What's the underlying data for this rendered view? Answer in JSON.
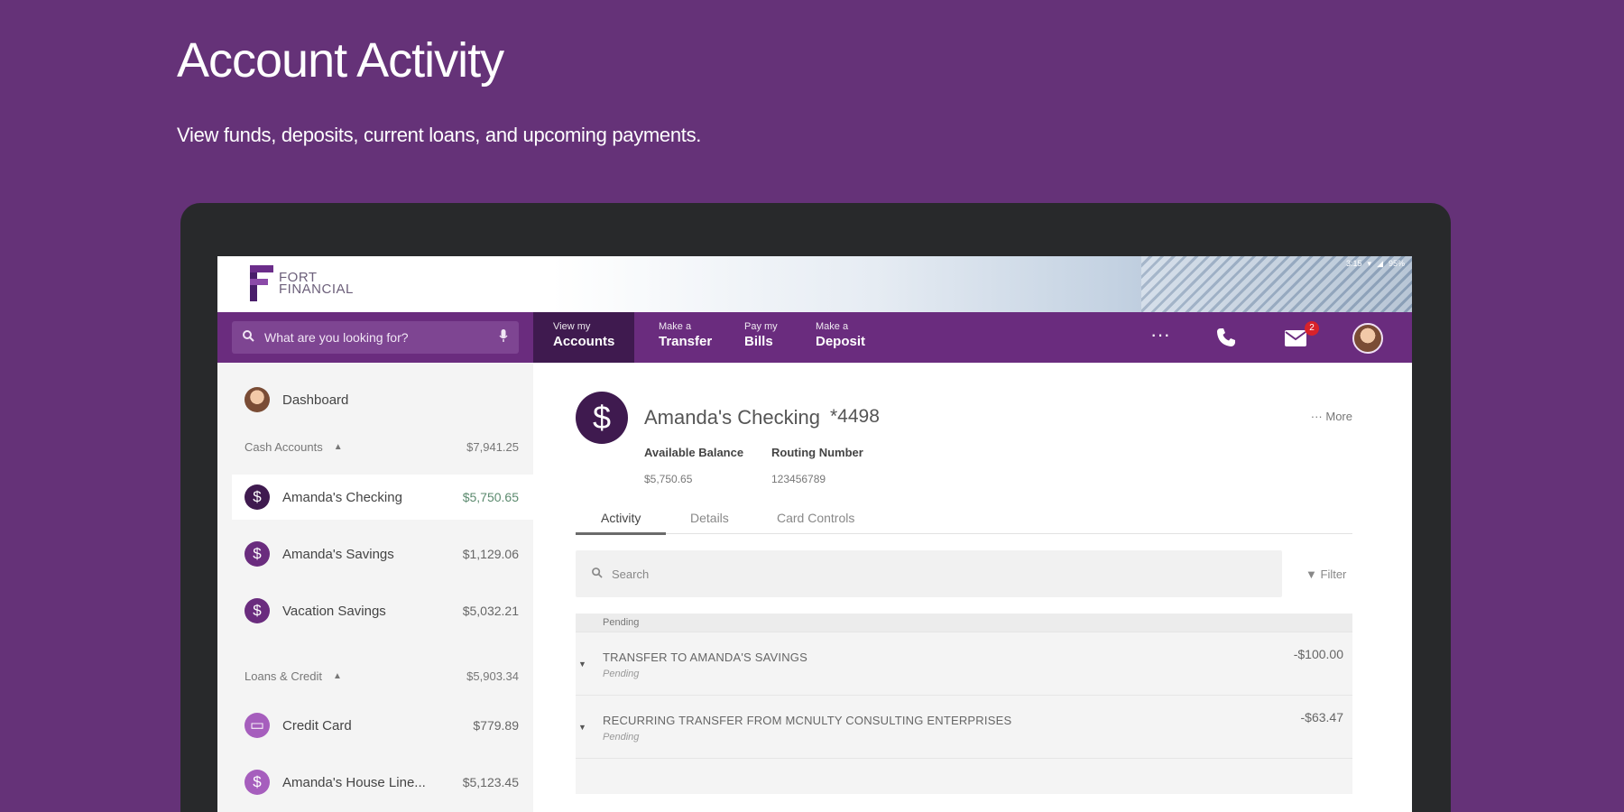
{
  "promo": {
    "title": "Account Activity",
    "subtitle": "View funds, deposits, current loans, and upcoming payments."
  },
  "status_bar": {
    "time": "3:15",
    "battery": "95%"
  },
  "brand": {
    "line1": "FORT",
    "line2": "FINANCIAL"
  },
  "nav": {
    "search_placeholder": "What are you looking for?",
    "tabs": [
      {
        "small": "View my",
        "large": "Accounts"
      },
      {
        "small": "Make a",
        "large": "Transfer"
      },
      {
        "small": "Pay my",
        "large": "Bills"
      },
      {
        "small": "Make a",
        "large": "Deposit"
      }
    ],
    "mail_badge": "2"
  },
  "sidebar": {
    "dashboard": "Dashboard",
    "cash_header": {
      "label": "Cash Accounts",
      "amount": "$7,941.25"
    },
    "cash_items": [
      {
        "label": "Amanda's Checking",
        "amount": "$5,750.65"
      },
      {
        "label": "Amanda's Savings",
        "amount": "$1,129.06"
      },
      {
        "label": "Vacation Savings",
        "amount": "$5,032.21"
      }
    ],
    "loans_header": {
      "label": "Loans & Credit",
      "amount": "$5,903.34"
    },
    "loan_items": [
      {
        "label": "Credit Card",
        "amount": "$779.89"
      },
      {
        "label": "Amanda's House Line...",
        "amount": "$5,123.45"
      }
    ]
  },
  "account": {
    "name": "Amanda's Checking",
    "number": "*4498",
    "more_label": "More",
    "available_balance_label": "Available Balance",
    "available_balance_value": "$5,750.65",
    "routing_label": "Routing Number",
    "routing_value": "123456789",
    "tabs": [
      "Activity",
      "Details",
      "Card Controls"
    ],
    "search_placeholder": "Search",
    "filter_label": "Filter",
    "pending_header": "Pending",
    "transactions": [
      {
        "description": "TRANSFER TO AMANDA'S SAVINGS",
        "status": "Pending",
        "amount": "-$100.00"
      },
      {
        "description": "RECURRING TRANSFER FROM MCNULTY CONSULTING ENTERPRISES",
        "status": "Pending",
        "amount": "-$63.47"
      }
    ]
  },
  "colors": {
    "brand_purple": "#653278",
    "nav_purple": "#6a2c7e",
    "nav_active": "#3f1a4f"
  }
}
